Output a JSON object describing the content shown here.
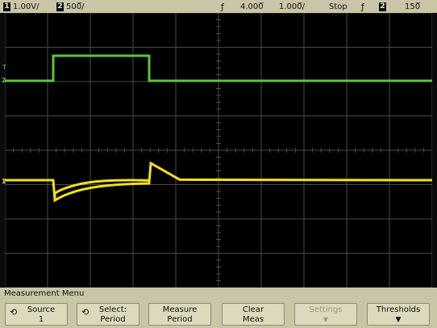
{
  "status_bar": {
    "ch1_number": "1",
    "ch1_scale": "1.00V/",
    "ch2_number": "2",
    "ch2_scale": "500̅/",
    "trigger_marker": "ƒ",
    "timebase_position": "4.000̅",
    "timebase_scale": "1.000̅/",
    "run_state": "Stop",
    "trigger_slope_icon": "rising-edge-icon",
    "trigger_source_number": "2",
    "trigger_level": "150̅"
  },
  "display": {
    "ch1_marker": "1",
    "ch2_marker": "2",
    "trigger_level_marker": "T",
    "colors": {
      "ch1_trace": "#f2e11a",
      "ch2_trace": "#5ec43a",
      "graticule": "#4a4a4a",
      "background": "#000000",
      "menu_bg": "#c9c6a8"
    }
  },
  "menu": {
    "title": "Measurement Menu",
    "softkeys": [
      {
        "icon": "rotate-knob-icon",
        "line1": "Source",
        "line2": "1",
        "enabled": true
      },
      {
        "icon": "rotate-knob-icon",
        "line1": "Select:",
        "line2": "Period",
        "enabled": true
      },
      {
        "icon": "",
        "line1": "Measure",
        "line2": "Period",
        "enabled": true
      },
      {
        "icon": "",
        "line1": "Clear",
        "line2": "Meas",
        "enabled": true
      },
      {
        "icon": "",
        "line1": "Settings",
        "line2": "",
        "enabled": false
      },
      {
        "icon": "",
        "line1": "Thresholds",
        "line2": "▼",
        "enabled": true
      }
    ]
  }
}
